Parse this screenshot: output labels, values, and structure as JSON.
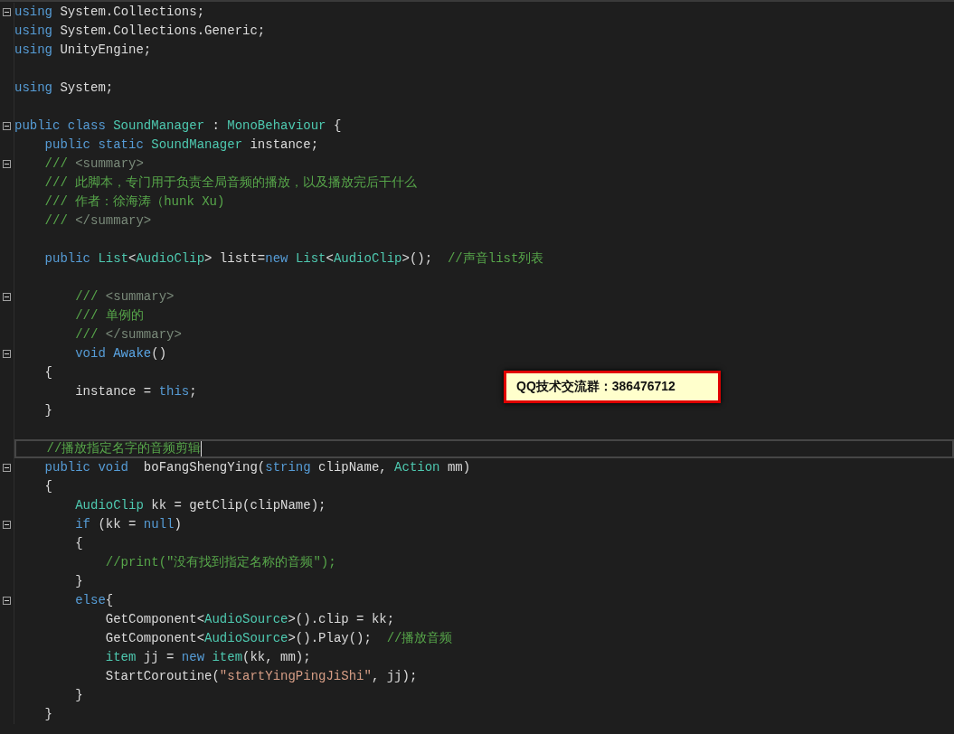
{
  "editor": {
    "blocks": [
      {
        "lines": [
          {
            "fold": true,
            "tokens": [
              {
                "kind": "kw",
                "text": "using"
              },
              {
                "kind": "plain",
                "text": " System.Collections;"
              }
            ]
          },
          {
            "tokens": [
              {
                "kind": "kw",
                "text": "using"
              },
              {
                "kind": "plain",
                "text": " System.Collections.Generic;"
              }
            ]
          },
          {
            "tokens": [
              {
                "kind": "kw",
                "text": "using"
              },
              {
                "kind": "plain",
                "text": " UnityEngine;"
              }
            ]
          }
        ]
      },
      {
        "lines": [
          {
            "tokens": [
              {
                "kind": "kw",
                "text": "using"
              },
              {
                "kind": "plain",
                "text": " System;"
              }
            ]
          }
        ]
      },
      {
        "lines": [
          {
            "fold": true,
            "tokens": [
              {
                "kind": "kw",
                "text": "public class "
              },
              {
                "kind": "type",
                "text": "SoundManager"
              },
              {
                "kind": "plain",
                "text": " : "
              },
              {
                "kind": "type",
                "text": "MonoBehaviour"
              },
              {
                "kind": "plain",
                "text": " {"
              }
            ]
          },
          {
            "tokens": [
              {
                "kind": "kw",
                "text": "    public static "
              },
              {
                "kind": "type",
                "text": "SoundManager"
              },
              {
                "kind": "plain",
                "text": " instance;"
              }
            ]
          },
          {
            "fold": true,
            "tokens": [
              {
                "kind": "doc",
                "text": "    /// "
              },
              {
                "kind": "doctag",
                "text": "<summary>"
              }
            ]
          },
          {
            "tokens": [
              {
                "kind": "doc",
                "text": "    /// 此脚本，专门用于负责全局音频的播放，以及播放完后干什么"
              }
            ]
          },
          {
            "tokens": [
              {
                "kind": "doc",
                "text": "    /// 作者：徐海涛（hunk Xu)"
              }
            ]
          },
          {
            "tokens": [
              {
                "kind": "doc",
                "text": "    /// "
              },
              {
                "kind": "doctag",
                "text": "</summary>"
              }
            ]
          }
        ]
      },
      {
        "lines": [
          {
            "tokens": [
              {
                "kind": "kw",
                "text": "    public "
              },
              {
                "kind": "type",
                "text": "List"
              },
              {
                "kind": "plain",
                "text": "<"
              },
              {
                "kind": "type",
                "text": "AudioClip"
              },
              {
                "kind": "plain",
                "text": "> listt="
              },
              {
                "kind": "kw",
                "text": "new "
              },
              {
                "kind": "type",
                "text": "List"
              },
              {
                "kind": "plain",
                "text": "<"
              },
              {
                "kind": "type",
                "text": "AudioClip"
              },
              {
                "kind": "plain",
                "text": ">();  "
              },
              {
                "kind": "comment",
                "text": "//声音list列表"
              }
            ]
          }
        ]
      },
      {
        "lines": [
          {
            "fold": true,
            "tokens": [
              {
                "kind": "doc",
                "text": "        /// "
              },
              {
                "kind": "doctag",
                "text": "<summary>"
              }
            ]
          },
          {
            "tokens": [
              {
                "kind": "doc",
                "text": "        /// 单例的"
              }
            ]
          },
          {
            "tokens": [
              {
                "kind": "doc",
                "text": "        /// "
              },
              {
                "kind": "doctag",
                "text": "</summary>"
              }
            ]
          },
          {
            "fold": true,
            "tokens": [
              {
                "kind": "kw",
                "text": "        void "
              },
              {
                "kind": "method",
                "text": "Awake"
              },
              {
                "kind": "plain",
                "text": "()"
              }
            ]
          },
          {
            "tokens": [
              {
                "kind": "plain",
                "text": "    {"
              }
            ]
          },
          {
            "tokens": [
              {
                "kind": "plain",
                "text": "        instance = "
              },
              {
                "kind": "kw",
                "text": "this"
              },
              {
                "kind": "plain",
                "text": ";"
              }
            ]
          },
          {
            "tokens": [
              {
                "kind": "plain",
                "text": "    }"
              }
            ]
          }
        ]
      },
      {
        "lines": [
          {
            "current": true,
            "tokens": [
              {
                "kind": "comment",
                "text": "    //播放指定名字的音频剪辑"
              }
            ]
          },
          {
            "fold": true,
            "tokens": [
              {
                "kind": "kw",
                "text": "    public void"
              },
              {
                "kind": "plain",
                "text": "  boFangShengYing("
              },
              {
                "kind": "kw",
                "text": "string"
              },
              {
                "kind": "plain",
                "text": " clipName, "
              },
              {
                "kind": "type",
                "text": "Action"
              },
              {
                "kind": "plain",
                "text": " mm)"
              }
            ]
          },
          {
            "tokens": [
              {
                "kind": "plain",
                "text": "    {"
              }
            ]
          },
          {
            "tokens": [
              {
                "kind": "type",
                "text": "        AudioClip"
              },
              {
                "kind": "plain",
                "text": " kk = getClip(clipName);"
              }
            ]
          },
          {
            "fold": true,
            "tokens": [
              {
                "kind": "kw",
                "text": "        if"
              },
              {
                "kind": "plain",
                "text": " (kk = "
              },
              {
                "kind": "kw",
                "text": "null"
              },
              {
                "kind": "plain",
                "text": ")"
              }
            ]
          },
          {
            "tokens": [
              {
                "kind": "plain",
                "text": "        {"
              }
            ]
          },
          {
            "tokens": [
              {
                "kind": "comment",
                "text": "            //print(\"没有找到指定名称的音频\");"
              }
            ]
          },
          {
            "tokens": [
              {
                "kind": "plain",
                "text": "        }"
              }
            ]
          },
          {
            "fold": true,
            "tokens": [
              {
                "kind": "kw",
                "text": "        else"
              },
              {
                "kind": "plain",
                "text": "{"
              }
            ]
          },
          {
            "tokens": [
              {
                "kind": "plain",
                "text": "            GetComponent<"
              },
              {
                "kind": "type",
                "text": "AudioSource"
              },
              {
                "kind": "plain",
                "text": ">().clip = kk;"
              }
            ]
          },
          {
            "tokens": [
              {
                "kind": "plain",
                "text": "            GetComponent<"
              },
              {
                "kind": "type",
                "text": "AudioSource"
              },
              {
                "kind": "plain",
                "text": ">().Play();  "
              },
              {
                "kind": "comment",
                "text": "//播放音频"
              }
            ]
          },
          {
            "tokens": [
              {
                "kind": "type",
                "text": "            item"
              },
              {
                "kind": "plain",
                "text": " jj = "
              },
              {
                "kind": "kw",
                "text": "new "
              },
              {
                "kind": "type",
                "text": "item"
              },
              {
                "kind": "plain",
                "text": "(kk, mm);"
              }
            ]
          },
          {
            "tokens": [
              {
                "kind": "plain",
                "text": "            StartCoroutine("
              },
              {
                "kind": "string",
                "text": "\"startYingPingJiShi\""
              },
              {
                "kind": "plain",
                "text": ", jj);"
              }
            ]
          },
          {
            "tokens": [
              {
                "kind": "plain",
                "text": "        }"
              }
            ]
          },
          {
            "tokens": [
              {
                "kind": "plain",
                "text": "    }"
              }
            ]
          }
        ]
      }
    ]
  },
  "callout": {
    "text": "QQ技术交流群：386476712"
  }
}
